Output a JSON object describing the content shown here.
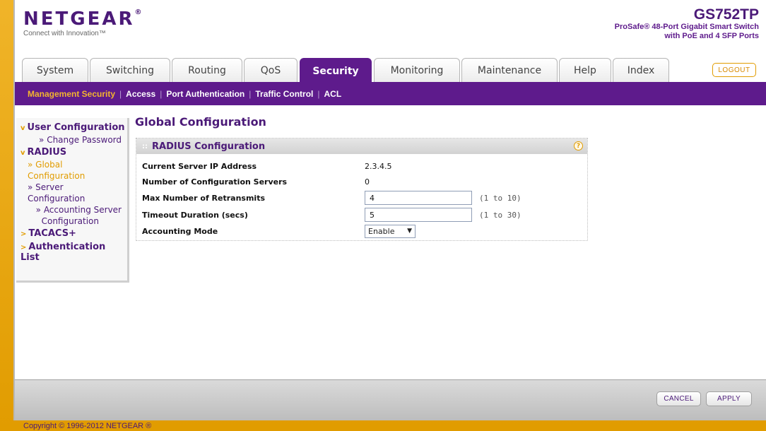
{
  "header": {
    "logo": "NETGEAR",
    "tagline": "Connect with Innovation™",
    "model_name": "GS752TP",
    "model_desc_line1": "ProSafe® 48-Port Gigabit Smart Switch",
    "model_desc_line2": "with PoE and 4 SFP Ports",
    "logout_label": "LOGOUT"
  },
  "tabs": [
    {
      "label": "System"
    },
    {
      "label": "Switching"
    },
    {
      "label": "Routing"
    },
    {
      "label": "QoS"
    },
    {
      "label": "Security"
    },
    {
      "label": "Monitoring"
    },
    {
      "label": "Maintenance"
    },
    {
      "label": "Help"
    },
    {
      "label": "Index"
    }
  ],
  "active_tab": "Security",
  "subnav": [
    {
      "label": "Management Security"
    },
    {
      "label": "Access"
    },
    {
      "label": "Port Authentication"
    },
    {
      "label": "Traffic Control"
    },
    {
      "label": "ACL"
    }
  ],
  "sidebar": {
    "user_config": "User Configuration",
    "change_password": "» Change Password",
    "radius": "RADIUS",
    "global_config_1": "» Global",
    "global_config_2": "Configuration",
    "server_config_1": "» Server",
    "server_config_2": "Configuration",
    "accounting_config_1": "» Accounting Server",
    "accounting_config_2": "Configuration",
    "tacacs": "TACACS+",
    "auth_list": "Authentication List"
  },
  "main": {
    "page_title": "Global Configuration",
    "panel_title": "RADIUS Configuration",
    "rows": {
      "current_server_ip_label": "Current Server IP Address",
      "current_server_ip_value": "2.3.4.5",
      "num_servers_label": "Number of Configuration Servers",
      "num_servers_value": "0",
      "max_retransmits_label": "Max Number of Retransmits",
      "max_retransmits_value": "4",
      "max_retransmits_hint": "(1 to 10)",
      "timeout_label": "Timeout Duration (secs)",
      "timeout_value": "5",
      "timeout_hint": "(1 to 30)",
      "accounting_mode_label": "Accounting Mode",
      "accounting_mode_value": "Enable"
    }
  },
  "footer": {
    "cancel_label": "CANCEL",
    "apply_label": "APPLY",
    "copyright": "Copyright © 1996-2012 NETGEAR ®"
  },
  "colors": {
    "brand_purple": "#5e1b8c",
    "accent_orange": "#e19c00"
  }
}
